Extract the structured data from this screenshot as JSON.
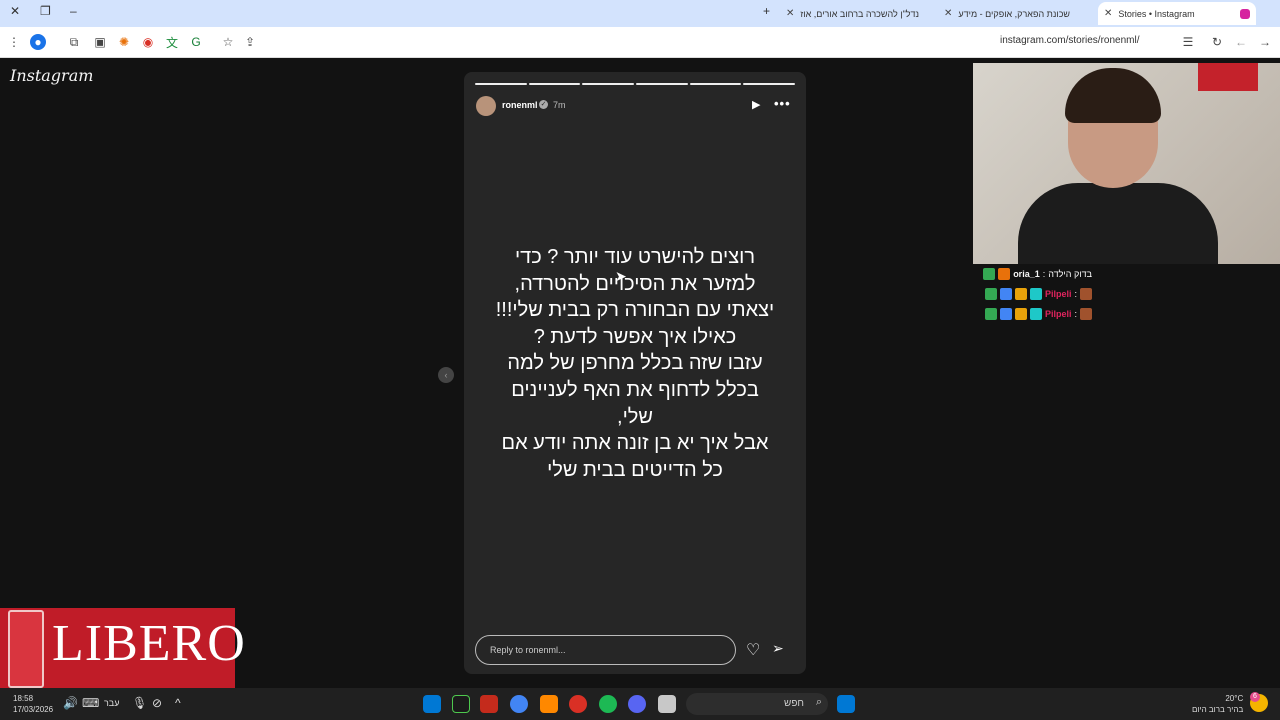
{
  "browser": {
    "tabs": [
      {
        "title": "Stories • Instagram"
      },
      {
        "title": "שכונת הפארק, אופקים - מידע"
      },
      {
        "title": "נדל\"ן להשכרה ברחוב אורים, אוז"
      }
    ],
    "url": "instagram.com/stories/ronenml/"
  },
  "instagram": {
    "logo": "Instagram",
    "story": {
      "username": "ronenml",
      "time_ago": "7m",
      "lines": [
        "רוצים להישרט עוד יותר ? כדי",
        "למזער את הסיכויים להטרדה,",
        "יצאתי עם הבחורה רק בבית שלי!!!",
        "כאילו איך אפשר לדעת ?",
        "עזבו שזה בכלל מחרפן של למה",
        "בכלל לדחוף את האף לעניינים",
        "שלי,",
        "אבל איך יא בן זונה אתה יודע אם",
        "כל הדייטים בבית שלי"
      ],
      "progress_segments_total": 6,
      "progress_segments_seen": 6,
      "reply_placeholder": "Reply to ronenml..."
    }
  },
  "stream_chat": [
    {
      "name": "oria_1",
      "message": "בדוק הילדה",
      "name_color": "#f5f5f5"
    },
    {
      "name": "Pilpeli",
      "message": "",
      "name_color": "#e0245e"
    },
    {
      "name": "Pilpeli",
      "message": "",
      "name_color": "#e0245e"
    }
  ],
  "ad": {
    "brand": "LIBERO"
  },
  "taskbar": {
    "time": "18:58",
    "date": "17/03/2026",
    "language": "עבר",
    "search_label": "חפש",
    "temperature": "20°C",
    "weather_desc": "בהיר ברוב היום",
    "notification_count": "6"
  }
}
